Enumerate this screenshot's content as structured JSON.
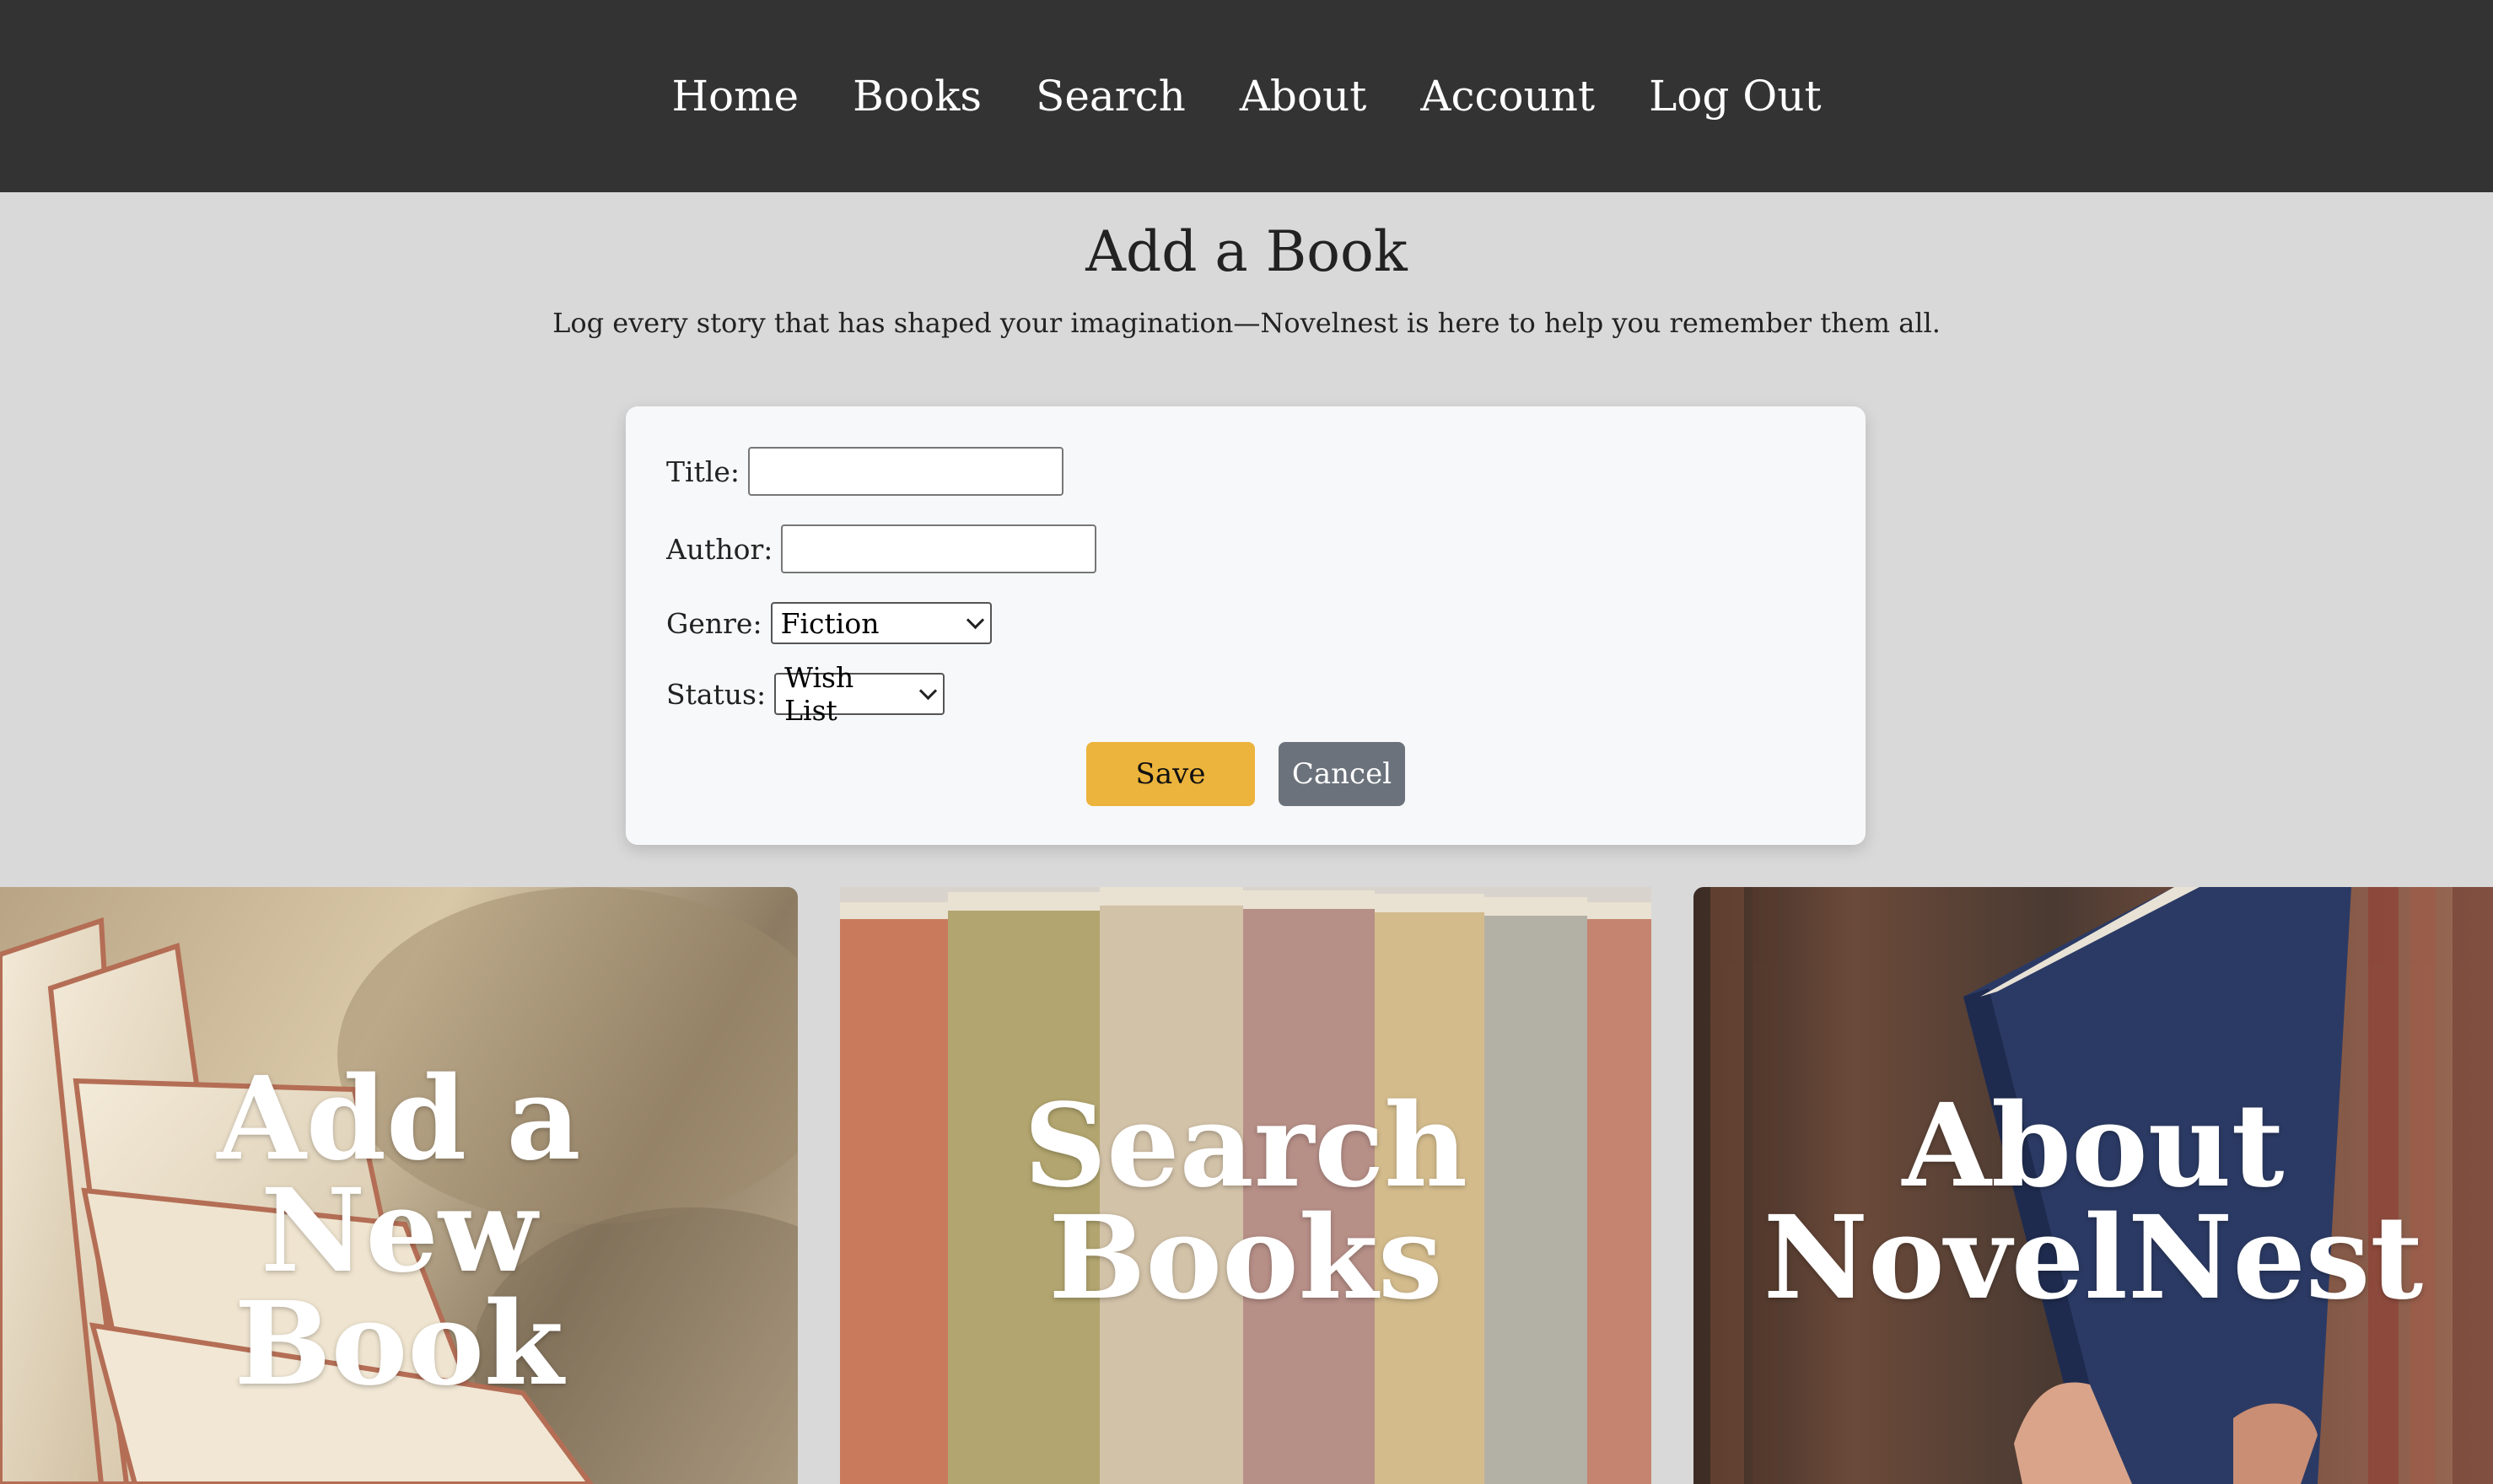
{
  "nav": {
    "items": [
      "Home",
      "Books",
      "Search",
      "About",
      "Account",
      "Log Out"
    ]
  },
  "page": {
    "title": "Add a Book",
    "subtitle": "Log every story that has shaped your imagination—Novelnest is here to help you remember them all."
  },
  "form": {
    "title_label": "Title:",
    "author_label": "Author:",
    "genre_label": "Genre:",
    "genre_value": "Fiction",
    "status_label": "Status:",
    "status_value": "Wish List",
    "save_label": "Save",
    "cancel_label": "Cancel"
  },
  "tiles": [
    {
      "label": "Add a New Book",
      "icon": "open-book-photo"
    },
    {
      "label": "Search Books",
      "icon": "book-spines-photo"
    },
    {
      "label": "About NovelNest",
      "icon": "hand-holding-book-photo"
    }
  ],
  "colors": {
    "nav_bg": "#333333",
    "page_bg": "#d9d9d9",
    "card_bg": "#f7f8f9",
    "save_bg": "#ecb43c",
    "cancel_bg": "#6b727b"
  }
}
